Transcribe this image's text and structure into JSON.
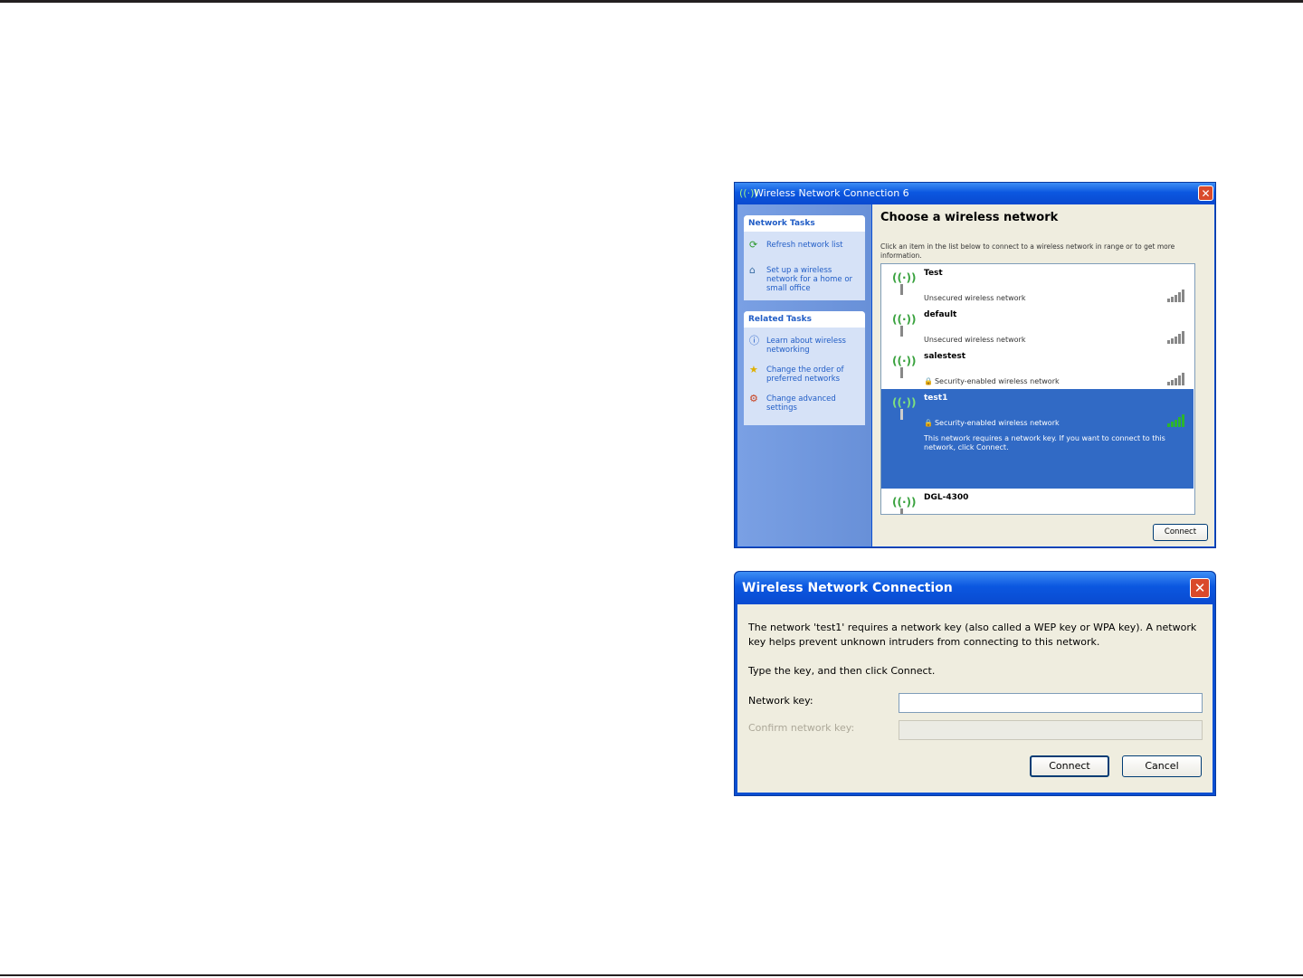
{
  "window1": {
    "title": "Wireless Network Connection 6",
    "sidebar": {
      "network_tasks": {
        "heading": "Network Tasks",
        "items": [
          {
            "icon": "refresh-icon",
            "label": "Refresh network list"
          },
          {
            "icon": "setup-network-icon",
            "label": "Set up a wireless network for a home or small office"
          }
        ]
      },
      "related_tasks": {
        "heading": "Related Tasks",
        "items": [
          {
            "icon": "info-icon",
            "label": "Learn about wireless networking"
          },
          {
            "icon": "star-icon",
            "label": "Change the order of preferred networks"
          },
          {
            "icon": "settings-icon",
            "label": "Change advanced settings"
          }
        ]
      }
    },
    "heading": "Choose a wireless network",
    "instruction": "Click an item in the list below to connect to a wireless network in range or to get more information.",
    "networks": [
      {
        "name": "Test",
        "status": "Unsecured wireless network",
        "secured": false,
        "signal_bars": 5,
        "selected": false
      },
      {
        "name": "default",
        "status": "Unsecured wireless network",
        "secured": false,
        "signal_bars": 5,
        "selected": false
      },
      {
        "name": "salestest",
        "status": "Security-enabled wireless network",
        "secured": true,
        "signal_bars": 5,
        "selected": false
      },
      {
        "name": "test1",
        "status": "Security-enabled wireless network",
        "secured": true,
        "signal_bars": 5,
        "selected": true,
        "message": "This network requires a network key. If you want to connect to this network, click Connect."
      },
      {
        "name": "DGL-4300",
        "status": "",
        "secured": false,
        "signal_bars": 5,
        "selected": false
      }
    ],
    "connect_button": "Connect"
  },
  "window2": {
    "title": "Wireless Network Connection",
    "message": "The network 'test1' requires a network key (also called a WEP key or WPA key). A network key helps prevent unknown intruders from connecting to this network.",
    "instruction": "Type the key, and then click Connect.",
    "network_key_label": "Network key:",
    "network_key_value": "",
    "confirm_key_label": "Confirm network key:",
    "confirm_key_value": "",
    "connect_button": "Connect",
    "cancel_button": "Cancel"
  },
  "colors": {
    "title_blue": "#0b57e0",
    "selection_blue": "#316ac5",
    "close_red": "#d94a2b",
    "dialog_bg": "#efeddf"
  }
}
